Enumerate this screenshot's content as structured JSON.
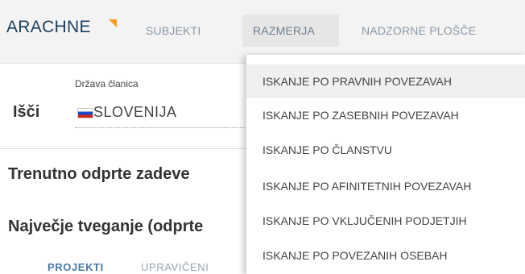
{
  "header": {
    "logo": "ARACHNE",
    "nav": {
      "subjekti": "SUBJEKTI",
      "razmerja": "RAZMERJA",
      "nadzorne": "NADZORNE PLOŠČE"
    }
  },
  "search": {
    "label": "Išči",
    "state_label": "Država članica",
    "country": "SLOVENIJA"
  },
  "sections": {
    "open_cases": "Trenutno odprte zadeve",
    "risk": "Največje tveganje (odprte"
  },
  "tabs": {
    "projekti": "PROJEKTI",
    "upraviceni": "UPRAVIČENI"
  },
  "dropdown": {
    "items": [
      "ISKANJE PO PRAVNIH POVEZAVAH",
      "ISKANJE PO ZASEBNIH POVEZAVAH",
      "ISKANJE PO ČLANSTVU",
      "ISKANJE PO AFINITETNIH POVEZAVAH",
      "ISKANJE PO VKLJUČENIH PODJETJIH",
      "ISKANJE PO POVEZANIH OSEBAH"
    ]
  },
  "colors": {
    "accent": "#f39c12",
    "brand": "#1c3f5e",
    "nav_text": "#8a98a6",
    "tab_active": "#4a77a6"
  }
}
